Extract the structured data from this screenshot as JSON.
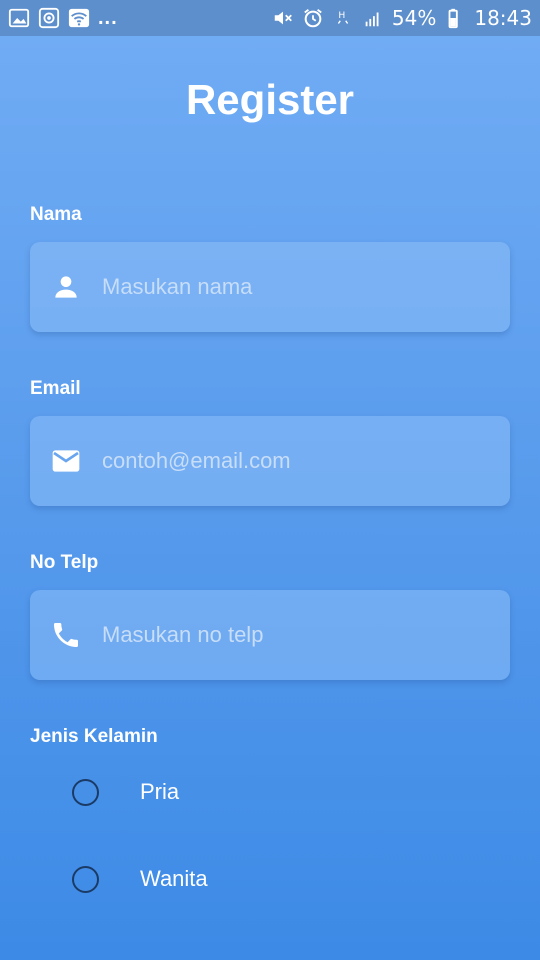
{
  "status_bar": {
    "left_icons": [
      "image-icon",
      "screenshot-icon",
      "wifi-icon"
    ],
    "overflow": "...",
    "right_icons": [
      "mute-icon",
      "alarm-icon",
      "network-h-icon",
      "signal-icon"
    ],
    "battery": "54%",
    "time": "18:43"
  },
  "page": {
    "title": "Register"
  },
  "form": {
    "nama": {
      "label": "Nama",
      "placeholder": "Masukan nama",
      "icon": "person-icon"
    },
    "email": {
      "label": "Email",
      "placeholder": "contoh@email.com",
      "icon": "mail-icon"
    },
    "telp": {
      "label": "No Telp",
      "placeholder": "Masukan no telp",
      "icon": "phone-icon"
    },
    "gender": {
      "label": "Jenis Kelamin",
      "options": [
        {
          "label": "Pria",
          "selected": false
        },
        {
          "label": "Wanita",
          "selected": false
        }
      ]
    }
  },
  "colors": {
    "gradient_top": "#72adf5",
    "gradient_bottom": "#3c8ae6",
    "status_bar": "#5d8fcc",
    "radio_border": "#1b3b66",
    "placeholder": "#c7ddf8"
  }
}
